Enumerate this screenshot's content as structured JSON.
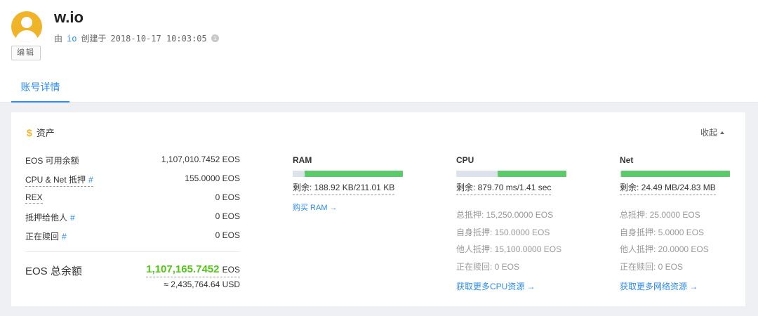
{
  "header": {
    "account_name": "w.io",
    "created_prefix": "由",
    "creator": "io",
    "created_label": "创建于",
    "created_time": "2018-10-17 10:03:05",
    "edit_label": "编辑"
  },
  "tabs": [
    {
      "label": "账号详情",
      "active": true
    }
  ],
  "assets": {
    "title": "资产",
    "collapse_label": "收起",
    "balances": [
      {
        "label": "EOS 可用余额",
        "hash": "",
        "value": "1,107,010.7452 EOS"
      },
      {
        "label": "CPU & Net 抵押",
        "hash": "#",
        "value": "155.0000 EOS"
      },
      {
        "label": "REX",
        "hash": "",
        "value": "0 EOS"
      },
      {
        "label": "抵押给他人",
        "hash": "#",
        "value": "0 EOS"
      },
      {
        "label": "正在赎回",
        "hash": "#",
        "value": "0 EOS"
      }
    ],
    "total": {
      "label": "EOS 总余额",
      "value": "1,107,165.7452",
      "unit": "EOS",
      "usd": "≈ 2,435,764.64 USD"
    }
  },
  "resources": {
    "ram": {
      "title": "RAM",
      "remaining_fraction": 0.895,
      "remain_text": "剩余: 188.92 KB/211.01 KB",
      "buy_link": "购买 RAM →"
    },
    "cpu": {
      "title": "CPU",
      "remaining_fraction": 0.623,
      "remain_text": "剩余: 879.70 ms/1.41 sec",
      "details": [
        "总抵押: 15,250.0000 EOS",
        "自身抵押: 150.0000 EOS",
        "他人抵押: 15,100.0000 EOS",
        "正在赎回: 0 EOS"
      ],
      "more_link": "获取更多CPU资源 →"
    },
    "net": {
      "title": "Net",
      "remaining_fraction": 0.986,
      "remain_text": "剩余: 24.49 MB/24.83 MB",
      "details": [
        "总抵押: 25.0000 EOS",
        "自身抵押: 5.0000 EOS",
        "他人抵押: 20.0000 EOS",
        "正在赎回: 0 EOS"
      ],
      "more_link": "获取更多网络资源 →"
    }
  },
  "colors": {
    "accent": "#2d8cf0",
    "usage_bar_fill": "#5cc96a",
    "usage_bar_track": "#dde3ea",
    "avatar": "#f0b429",
    "total_balance": "#52c41a"
  }
}
